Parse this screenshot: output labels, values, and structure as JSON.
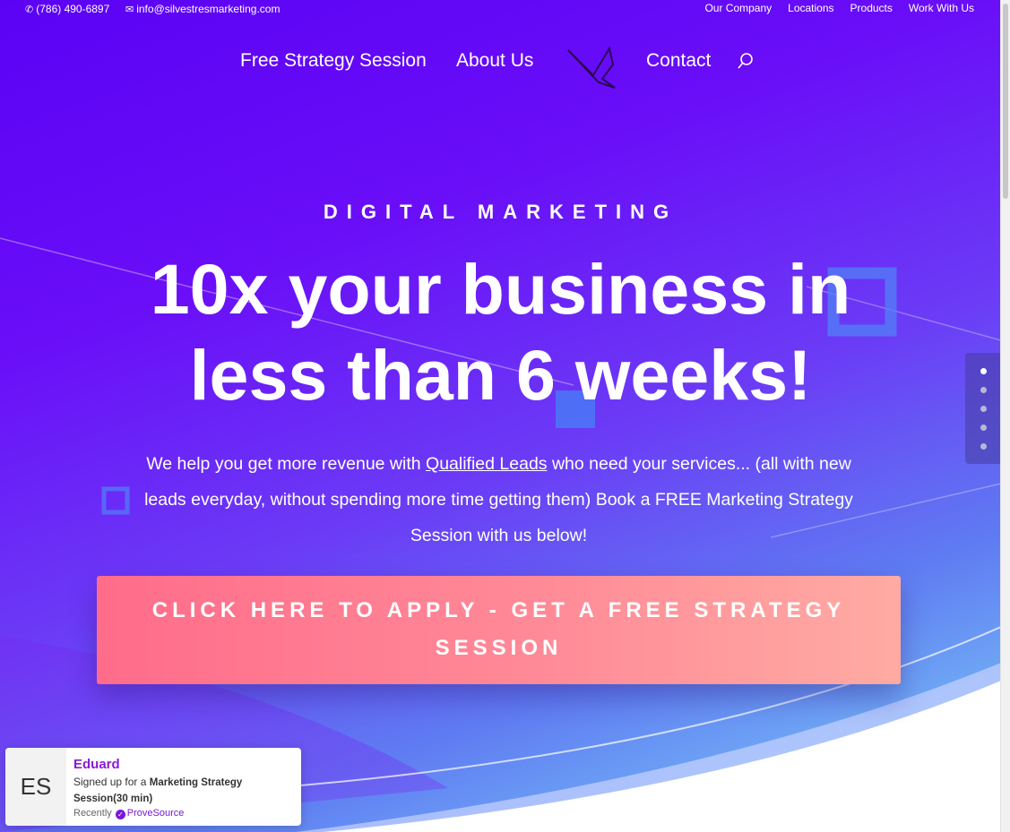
{
  "topbar": {
    "phone": "(786) 490-6897",
    "email": "info@silvestresmarketing.com",
    "links": [
      "Our Company",
      "Locations",
      "Products",
      "Work With Us"
    ]
  },
  "nav": {
    "free_strategy": "Free Strategy Session",
    "about": "About Us",
    "contact": "Contact"
  },
  "hero": {
    "eyebrow": "DIGITAL MARKETING",
    "headline_line1": "10x your business in",
    "headline_line2": "less than 6 weeks!",
    "sub_before": "We help you get more revenue with ",
    "sub_link": "Qualified Leads",
    "sub_after": " who need your services... (all with new leads everyday, without spending more time getting them) Book a FREE Marketing Strategy Session with us below!",
    "cta": "CLICK HERE TO APPLY - GET A FREE STRATEGY SESSION"
  },
  "dot_nav": {
    "count": 5,
    "active": 0
  },
  "toast": {
    "initials": "ES",
    "name": "Eduard",
    "msg_prefix": "Signed up for a ",
    "msg_bold": "Marketing Strategy Session(30 min)",
    "time": "Recently",
    "brand": "ProveSource",
    "brand_color": "#7a18d8"
  },
  "colors": {
    "hero_start": "#5b02f5",
    "hero_end": "#7fd7f7",
    "cta_start": "#ff6c8a",
    "cta_end": "#ffaba3"
  }
}
